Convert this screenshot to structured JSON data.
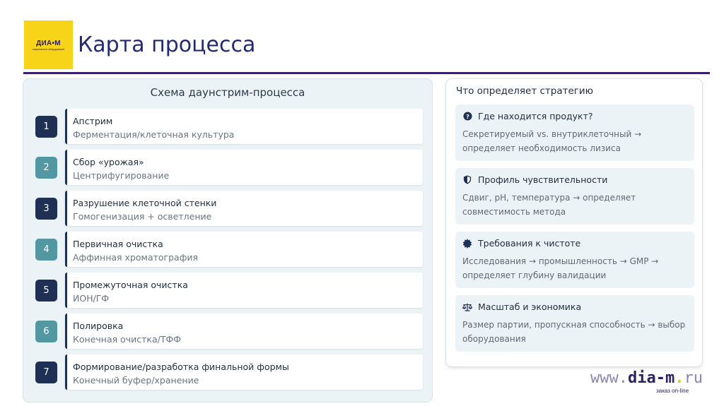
{
  "logo": {
    "main": "ДИА•М",
    "sub": "современное оборудование"
  },
  "page_title": "Карта процесса",
  "left": {
    "title": "Схема даунстрим-процесса",
    "steps": [
      {
        "num": "1",
        "title": "Апстрим",
        "sub": "Ферментация/клеточная культура"
      },
      {
        "num": "2",
        "title": "Сбор «урожая»",
        "sub": "Центрифугирование"
      },
      {
        "num": "3",
        "title": "Разрушение клеточной стенки",
        "sub": "Гомогенизация + осветление"
      },
      {
        "num": "4",
        "title": "Первичная очистка",
        "sub": "Аффинная хроматография"
      },
      {
        "num": "5",
        "title": "Промежуточная очистка",
        "sub": "ИОН/ГФ"
      },
      {
        "num": "6",
        "title": "Полировка",
        "sub": "Конечная очистка/ТФФ"
      },
      {
        "num": "7",
        "title": "Формирование/разработка финальной формы",
        "sub": "Конечный буфер/хранение"
      }
    ]
  },
  "right": {
    "title": "Что определяет стратегию",
    "cards": [
      {
        "icon": "question-circle-icon",
        "head": "Где находится продукт?",
        "text": "Секретируемый vs. внутриклеточный → определяет необходимость лизиса"
      },
      {
        "icon": "shield-icon",
        "head": "Профиль чувствительности",
        "text": "Сдвиг, pH, температура → определяет совместимость метода"
      },
      {
        "icon": "certificate-badge-icon",
        "head": "Требования к чистоте",
        "text": "Исследования → промышленность → GMP → определяет глубину валидации"
      },
      {
        "icon": "balance-scale-icon",
        "head": "Масштаб и экономика",
        "text": "Размер партии, пропускная способность → выбор оборудования"
      }
    ]
  },
  "footer": {
    "www": "www.",
    "name": "dia-m",
    "ru": "ru",
    "tagline": "заказ on-line"
  },
  "colors": {
    "navy": "#1f3055",
    "teal": "#5397a3",
    "title": "#222a74",
    "divider": "#3c1e70",
    "logo_bg": "#f7d417"
  }
}
